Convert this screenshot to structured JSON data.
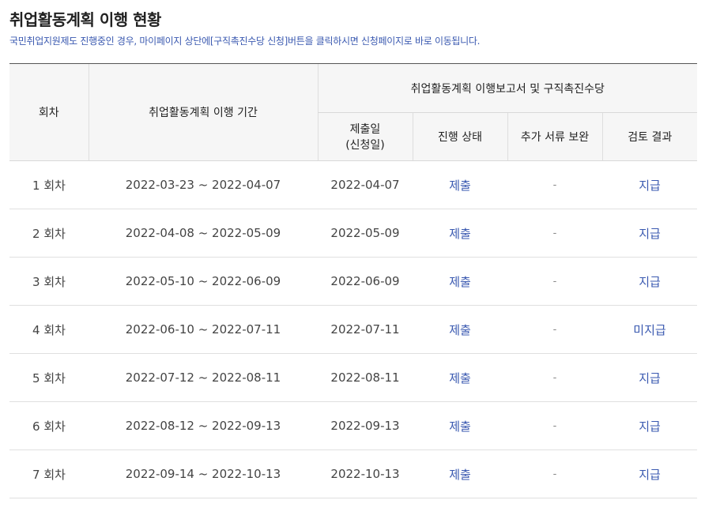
{
  "page": {
    "title": "취업활동계획 이행 현황",
    "notice": "국민취업지원제도 진행중인 경우, 마이페이지 상단에[구직촉진수당 신청]버튼을 클릭하시면 신청페이지로 바로 이동됩니다."
  },
  "table": {
    "headers": {
      "round": "회차",
      "period": "취업활동계획 이행 기간",
      "group": "취업활동계획 이행보고서 및 구직촉진수당",
      "submit_date_line1": "제출일",
      "submit_date_line2": "(신청일)",
      "status": "진행 상태",
      "supplement": "추가 서류 보완",
      "review": "검토 결과"
    },
    "rows": [
      {
        "round": "1 회차",
        "period": "2022-03-23 ~ 2022-04-07",
        "submit_date": "2022-04-07",
        "status": "제출",
        "supplement": "-",
        "review": "지급"
      },
      {
        "round": "2 회차",
        "period": "2022-04-08 ~ 2022-05-09",
        "submit_date": "2022-05-09",
        "status": "제출",
        "supplement": "-",
        "review": "지급"
      },
      {
        "round": "3 회차",
        "period": "2022-05-10 ~ 2022-06-09",
        "submit_date": "2022-06-09",
        "status": "제출",
        "supplement": "-",
        "review": "지급"
      },
      {
        "round": "4 회차",
        "period": "2022-06-10 ~ 2022-07-11",
        "submit_date": "2022-07-11",
        "status": "제출",
        "supplement": "-",
        "review": "미지급"
      },
      {
        "round": "5 회차",
        "period": "2022-07-12 ~ 2022-08-11",
        "submit_date": "2022-08-11",
        "status": "제출",
        "supplement": "-",
        "review": "지급"
      },
      {
        "round": "6 회차",
        "period": "2022-08-12 ~ 2022-09-13",
        "submit_date": "2022-09-13",
        "status": "제출",
        "supplement": "-",
        "review": "지급"
      },
      {
        "round": "7 회차",
        "period": "2022-09-14 ~ 2022-10-13",
        "submit_date": "2022-10-13",
        "status": "제출",
        "supplement": "-",
        "review": "지급"
      }
    ]
  },
  "colors": {
    "link": "#3a59b0",
    "header_bg": "#f6f6f6",
    "top_border": "#555555"
  }
}
